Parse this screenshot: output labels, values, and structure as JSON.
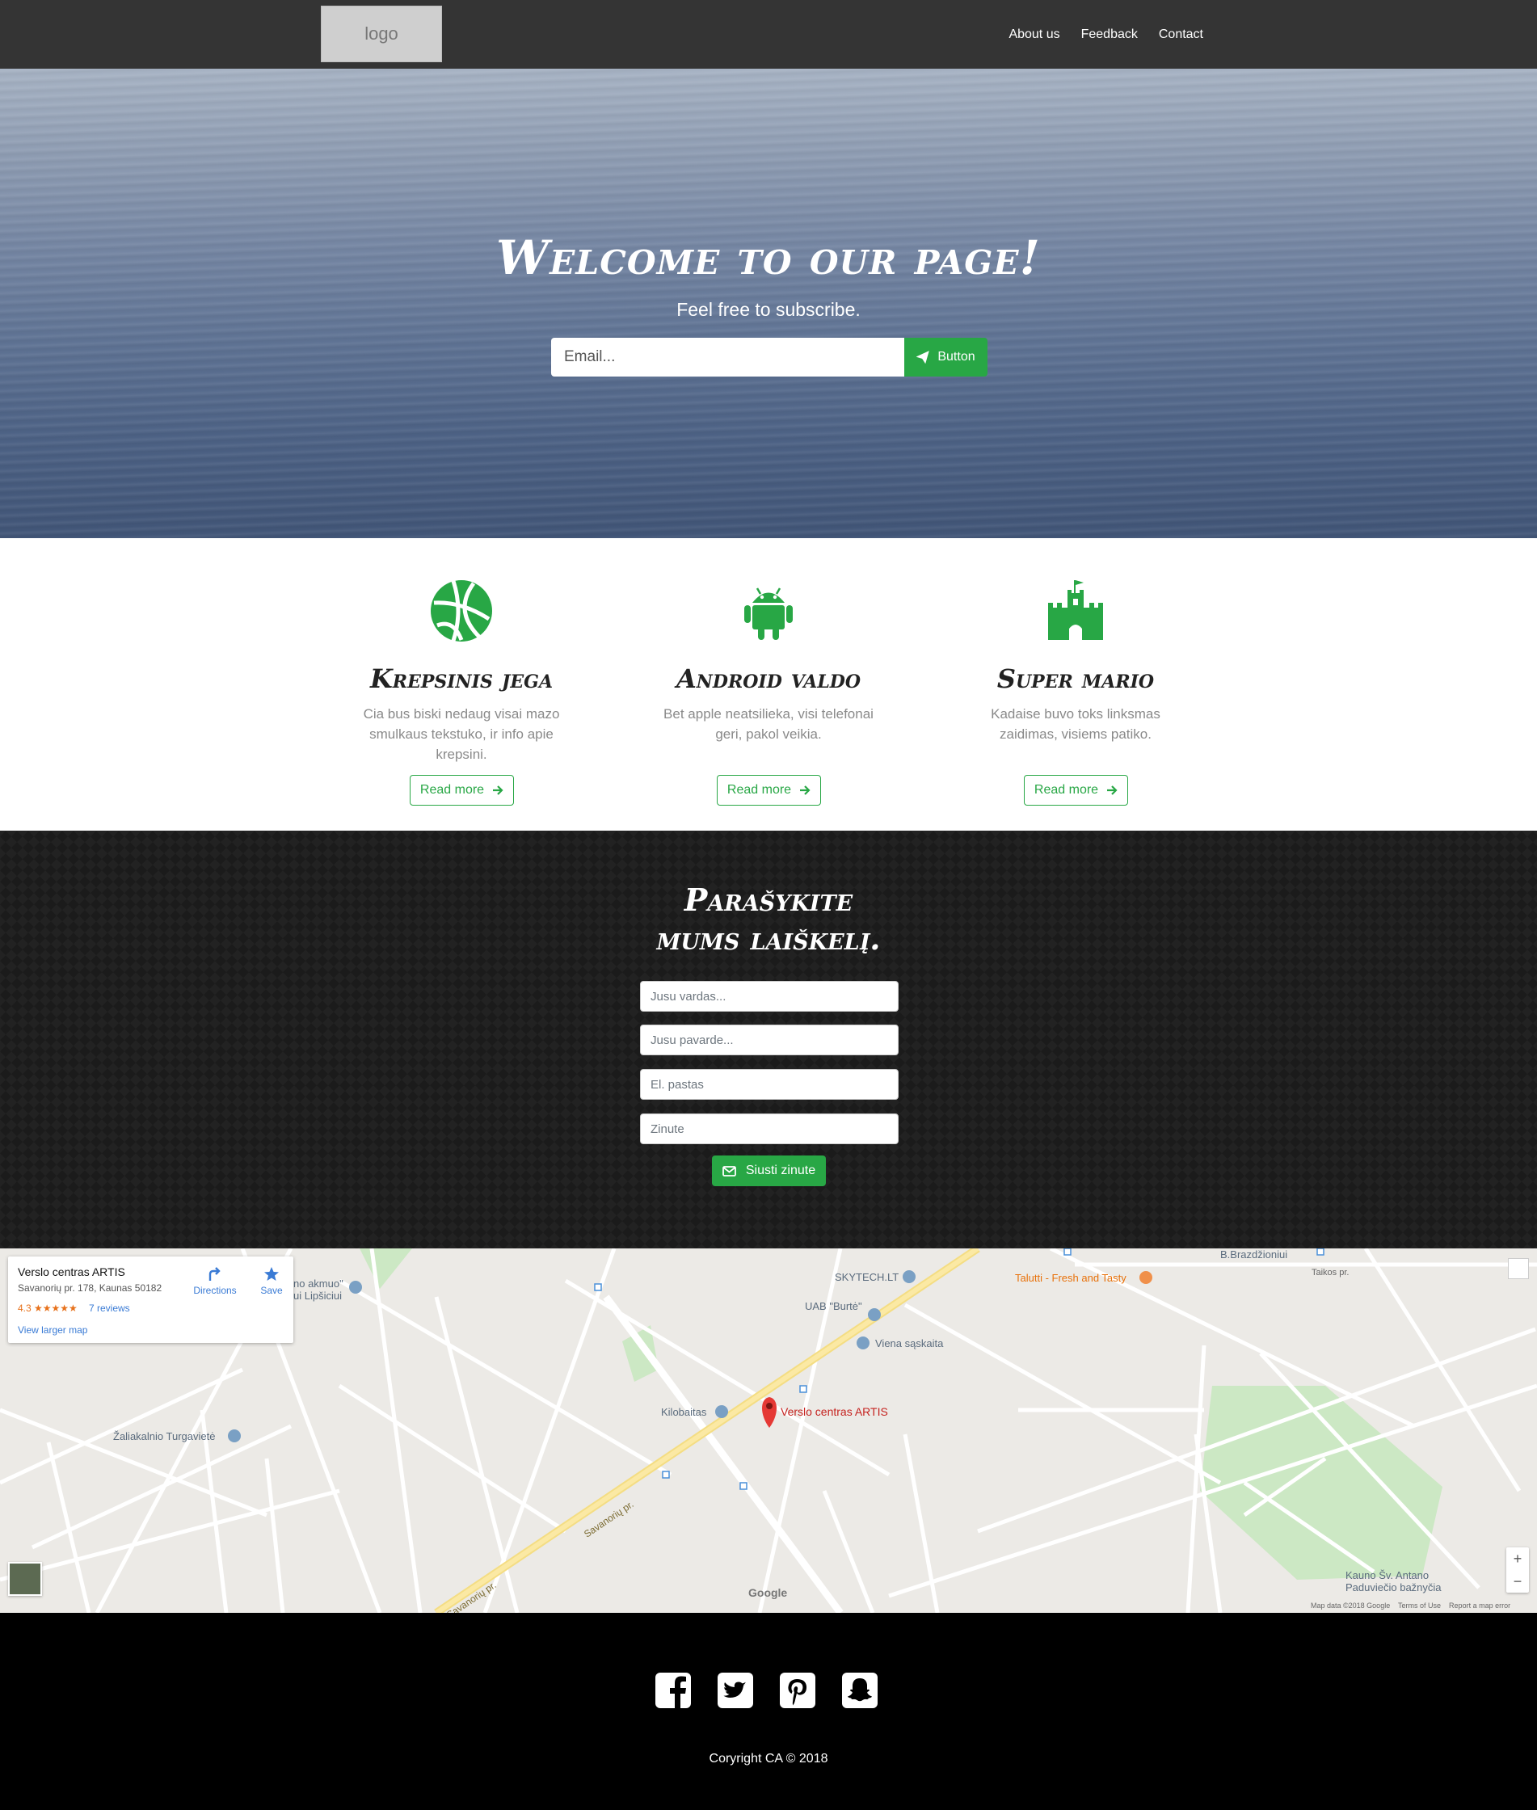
{
  "nav": {
    "logo": "logo",
    "links": [
      "About us",
      "Feedback",
      "Contact"
    ]
  },
  "hero": {
    "title": "Welcome to our page!",
    "subtitle": "Feel free to subscribe.",
    "email_placeholder": "Email...",
    "button_label": "Button"
  },
  "features": [
    {
      "icon": "basketball-icon",
      "title": "Krepsinis jega",
      "text": "Cia bus biski nedaug visai mazo smulkaus tekstuko, ir info apie krepsini.",
      "button": "Read more"
    },
    {
      "icon": "android-icon",
      "title": "Android valdo",
      "text": "Bet apple neatsilieka, visi telefonai geri, pakol veikia.",
      "button": "Read more"
    },
    {
      "icon": "castle-icon",
      "title": "Super mario",
      "text": "Kadaise buvo toks linksmas zaidimas, visiems patiko.",
      "button": "Read more"
    }
  ],
  "contact": {
    "title_line1": "Parašykite",
    "title_line2": "mums laiškelį.",
    "fields": [
      "Jusu vardas...",
      "Jusu pavarde...",
      "El. pastas",
      "Zinute"
    ],
    "send_label": "Siusti zinute"
  },
  "map": {
    "place_name": "Verslo centras ARTIS",
    "address": "Savanorių pr. 178, Kaunas 50182",
    "rating": "4.3 ★★★★★",
    "reviews": "7 reviews",
    "larger_map": "View larger map",
    "directions": "Directions",
    "save": "Save",
    "labels": {
      "skytech": "SKYTECH.LT",
      "burte": "UAB \"Burtė\"",
      "viena": "Viena sąskaita",
      "kilobaitas": "Kilobaitas",
      "artis": "Verslo centras ARTIS",
      "talutti": "Talutti - Fresh and Tasty",
      "turgaviete": "Žaliakalnio Turgavietė",
      "akmuo": "no akmuo\"\nui Lipšiciui",
      "brazdzioniui": "B.Brazdžioniui",
      "taikos": "Taikos pr.",
      "antano": "Kauno Šv. Antano\nPaduviečio bažnyčia",
      "savanoriu": "Savanorių pr.",
      "savanoriu2": "Savanorių pr.",
      "google": "Google",
      "attribution": "Map data ©2018 Google    Terms of Use    Report a map error"
    }
  },
  "footer": {
    "social_icons": [
      "facebook-icon",
      "twitter-icon",
      "pinterest-icon",
      "snapchat-icon"
    ],
    "copyright": "Coryright CA © 2018"
  },
  "colors": {
    "accent": "#28a745",
    "nav": "#343434",
    "footer": "#000000"
  }
}
